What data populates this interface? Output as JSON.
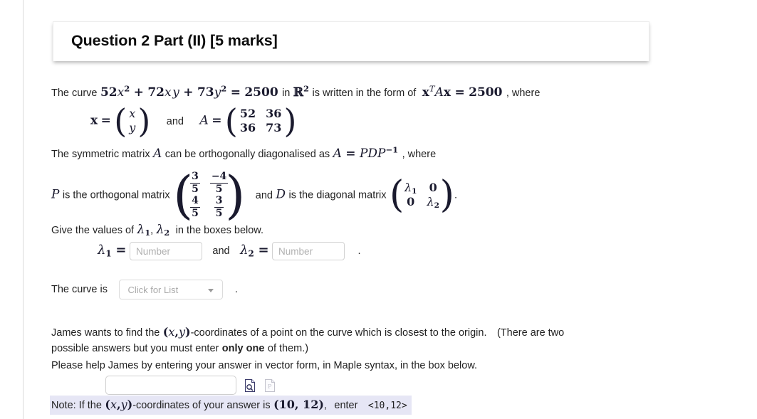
{
  "header": {
    "title": "Question 2 Part (II) [5 marks]"
  },
  "question": {
    "line1_prefix": "The curve",
    "equation_quadratic": {
      "c1": "52",
      "v1": "x",
      "e1": "2",
      "plus1": "+",
      "c2": "72",
      "v2a": "x",
      "v2b": "y",
      "plus2": "+",
      "c3": "73",
      "v3": "y",
      "e3": "2",
      "eq": "=",
      "rhs": "2500"
    },
    "line1_in": "in",
    "field_symbol": "R",
    "field_exp": "2",
    "line1_mid": "is written in the form of",
    "quadratic_form": {
      "x_bold": "x",
      "transpose": "T",
      "A": "A",
      "x_bold2": "x",
      "eq": "=",
      "rhs": "2500"
    },
    "line1_suffix": ", where",
    "x_def": {
      "x_bold": "x",
      "eq": "=",
      "row1": "x",
      "row2": "y"
    },
    "and_word": "and",
    "A_def": {
      "A": "A",
      "eq": "=",
      "rows": [
        [
          "52",
          "36"
        ],
        [
          "36",
          "73"
        ]
      ]
    },
    "line2": {
      "prefix": "The symmetric matrix",
      "A": "A",
      "mid": "can be orthogonally diagonalised as",
      "eq_lhs": "A",
      "eq_sign": "=",
      "eq_rhs": "PDP",
      "eq_exp": "−1",
      "suffix": ", where"
    },
    "line3": {
      "P": "P",
      "prefix": "is the orthogonal matrix",
      "P_rows": [
        [
          {
            "num": "3",
            "den": "5"
          },
          {
            "num": "−4",
            "den": "5"
          }
        ],
        [
          {
            "num": "4",
            "den": "5"
          },
          {
            "num": "3",
            "den": "5"
          }
        ]
      ],
      "and_word": "and",
      "D": "D",
      "mid": "is the diagonal matrix",
      "D_rows": [
        [
          {
            "sym": "λ",
            "sub": "1"
          },
          {
            "sym": "0",
            "sub": ""
          }
        ],
        [
          {
            "sym": "0",
            "sub": ""
          },
          {
            "sym": "λ",
            "sub": "2"
          }
        ]
      ],
      "period": "."
    },
    "line4": {
      "prefix": "Give the values of",
      "lambda": "λ",
      "sub1": "1",
      "comma": ",",
      "lambda2": "λ",
      "sub2": "2",
      "suffix": "in the boxes below."
    }
  },
  "inputs": {
    "lambda1_label": {
      "sym": "λ",
      "sub": "1",
      "eq": "="
    },
    "lambda1_value": "",
    "lambda1_placeholder": "Number",
    "and_word": "and",
    "lambda2_label": {
      "sym": "λ",
      "sub": "2",
      "eq": "="
    },
    "lambda2_value": "",
    "lambda2_placeholder": "Number",
    "trailing_period": "."
  },
  "curve_row": {
    "label": "The curve is",
    "dropdown_value": "Click for List",
    "dropdown_icon": "chevron-down-icon",
    "trailing_period": "."
  },
  "prose": {
    "p1_a": "James wants to find the",
    "p1_coords": {
      "open": "(",
      "x": "x",
      "comma": ",",
      "y": "y",
      "close": ")"
    },
    "p1_b": "-coordinates of a point on the curve which is closest to the origin.",
    "p1_c": "(There are two",
    "p2_a": "possible answers but you must enter",
    "p2_bold": "only one",
    "p2_b": "of them.)",
    "p3": "Please help James by entering your answer in vector form, in Maple syntax, in the box below."
  },
  "answer": {
    "value": "",
    "placeholder": "",
    "icon_preview": "document-search-icon",
    "icon_secondary": "document-disabled-icon"
  },
  "note": {
    "prefix": "Note: If the",
    "coords": {
      "open": "(",
      "x": "x",
      "comma": ",",
      "y": "y",
      "close": ")"
    },
    "mid": "-coordinates of your answer is",
    "example_point": "(10, 12)",
    "comma": ",",
    "enter_word": "enter",
    "syntax": "<10,12>",
    "highlight_color": "#e6e6f5"
  }
}
